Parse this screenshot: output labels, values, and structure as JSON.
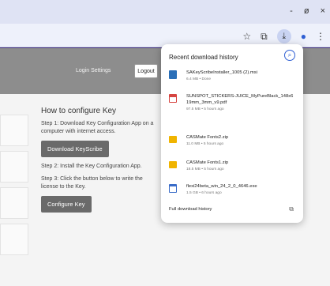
{
  "window": {
    "controls": [
      "-",
      "ø",
      "×"
    ]
  },
  "toolbar": {
    "icons": [
      "star-icon",
      "extension-icon",
      "download-icon",
      "profile-icon",
      "menu-icon"
    ],
    "glyphs": [
      "☆",
      "⧉",
      "⤓",
      "●",
      "⋮"
    ]
  },
  "page": {
    "header": {
      "login_settings": "Login Settings",
      "logout": "Logout"
    },
    "title": "How to configure Key",
    "step1": "Step 1: Download Key Configuration App on a computer with internet access.",
    "download_button": "Download KeyScribe",
    "step2": "Step 2: Install the Key Configuration App.",
    "step3": "Step 3: Click the button below to write the license to the Key.",
    "configure_button": "Configure Key"
  },
  "downloads": {
    "title": "Recent download history",
    "items": [
      {
        "name": "SAKeyScribeInstaller_1005 (2).msi",
        "meta": "6.4 MB • Done",
        "icon": "installer-icon",
        "color": "#2a6fb8"
      },
      {
        "name": "SUNSPOT_STICKERS-JUICE_MyPureBlack_148x619mm_3mm_v9.pdf",
        "meta": "97.5 MB • 5 hours ago",
        "icon": "pdf-icon",
        "color": "#d64541"
      },
      {
        "name": "CASMate Fonts2.zip",
        "meta": "11.0 MB • 5 hours ago",
        "icon": "folder-icon",
        "color": "#f0b400"
      },
      {
        "name": "CASMate Fonts1.zip",
        "meta": "18.5 MB • 5 hours ago",
        "icon": "folder-icon",
        "color": "#f0b400"
      },
      {
        "name": "flexi24beta_win_24_2_0_4646.exe",
        "meta": "1.5 GB • 6 hours ago",
        "icon": "executable-icon",
        "color": "#3a6cc8"
      }
    ],
    "full_history": "Full download history"
  }
}
